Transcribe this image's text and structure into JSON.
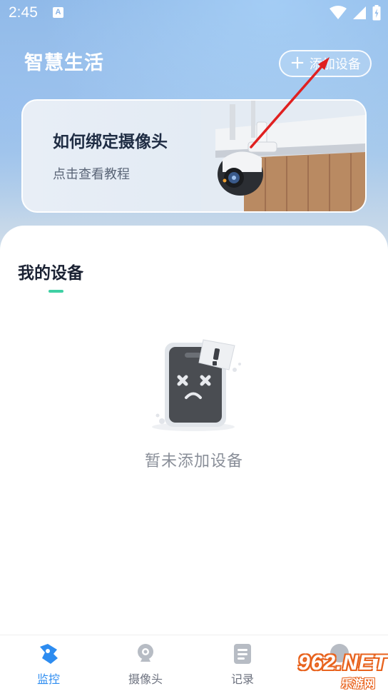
{
  "status_bar": {
    "time": "2:45",
    "notification_badge": "A",
    "icons": [
      "wifi-icon",
      "signal-icon",
      "battery-icon"
    ]
  },
  "header": {
    "title": "智慧生活",
    "add_device_label": "添加设备"
  },
  "banner": {
    "title": "如何绑定摄像头",
    "subtitle": "点击查看教程"
  },
  "devices": {
    "section_title": "我的设备",
    "empty_text": "暂未添加设备"
  },
  "bottom_nav": {
    "items": [
      {
        "label": "监控",
        "icon": "monitor-icon",
        "active": true
      },
      {
        "label": "摄像头",
        "icon": "camera-icon",
        "active": false
      },
      {
        "label": "记录",
        "icon": "record-icon",
        "active": false
      },
      {
        "label": "",
        "icon": "profile-icon",
        "active": false
      }
    ]
  },
  "watermark": {
    "text": "962.NET",
    "subtext": "乐游网"
  },
  "colors": {
    "accent": "#3fd0a4",
    "nav_active": "#2d8cf0",
    "annotation_arrow": "#e02020"
  }
}
